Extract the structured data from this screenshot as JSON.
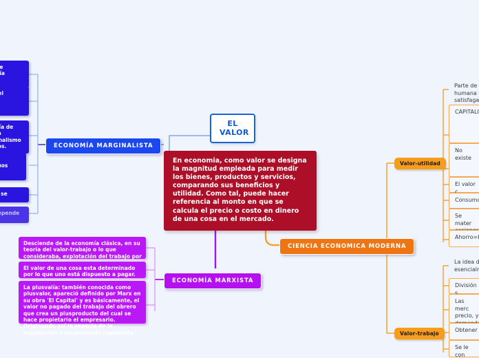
{
  "app": {
    "type": "mind-map",
    "background_color": "#f0f4fc"
  },
  "root": {
    "label": "EL VALOR",
    "color": "#1358cc"
  },
  "central_description": {
    "text": "En economia, como valor se designa la magnitud empleada para medir los bienes, productos y servicios, comparando sus beneficios y utilidad. Como tal, puede hacer referencia al monto en que se calcula el precio o costo en dinero de una cosa en el mercado.",
    "color": "#ad0f28"
  },
  "branches": [
    {
      "id": "marginalista",
      "label": "ECONOMÍA MARGINALISTA",
      "color": "#1a47f0",
      "leaves": [
        {
          "text": "e que\nnomía"
        },
        {
          "text": "ara el\nalor\nos,"
        },
        {
          "text": "teoría de\nde la\narginalismo\nrecios."
        },
        {
          "text": "te\nividuos"
        },
        {
          "text": "a, si se"
        },
        {
          "text": "a, depende"
        }
      ]
    },
    {
      "id": "marxista",
      "label": "ECONOMÍA MARXISTA",
      "color": "#b510f0",
      "leaves": [
        {
          "text": "Desciende de la economía clásica, en su teoría del valor-trabajo o lo que consideraba, explotación del trabajo por el capital."
        },
        {
          "text": "El valor de una cosa esta determinado por lo que uno está dispuesto a pagar."
        },
        {
          "text": "La plusvalía: también conocida como plusvalor, apareció definido por Marx en su obra 'El Capital' y es básicamente, el valor no pagado del trabajo del obrero que crea un plusproducto del cual se hace propietario el empresario. Originando así la esencia de la explotación o acumulación capitalista."
        }
      ]
    },
    {
      "id": "moderna",
      "label": "CIENCIA ECONOMICA MODERNA",
      "color": "#ee7512",
      "subbranches": [
        {
          "id": "valor-utilidad",
          "label": "Valor-utilidad",
          "color": "#f79c1b",
          "leaves": [
            {
              "text": "Parte de\nhumana\nsatisfaga",
              "boxed": false
            },
            {
              "text": "CAPITALI",
              "boxed": true
            },
            {
              "text": "No existe",
              "boxed": true
            },
            {
              "text": "El valor c",
              "boxed": true
            },
            {
              "text": "Consumo",
              "boxed": true
            },
            {
              "text": "Se mater\nacciones",
              "boxed": true
            },
            {
              "text": "Ahorro=I",
              "boxed": true
            }
          ]
        },
        {
          "id": "valor-trabajo",
          "label": "Valor-trabajo",
          "color": "#f79c1b",
          "leaves": [
            {
              "text": "La idea d\nesencialm",
              "boxed": false
            },
            {
              "text": "División s",
              "boxed": true
            },
            {
              "text": "Las merc\nprecio, y\ndemanda",
              "boxed": true
            },
            {
              "text": "Obtener",
              "boxed": true
            },
            {
              "text": "Se le con",
              "boxed": true
            }
          ]
        }
      ]
    }
  ]
}
